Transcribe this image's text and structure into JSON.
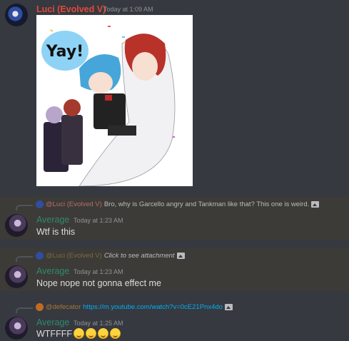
{
  "messages": [
    {
      "author": "Luci (Evolved V)",
      "timestamp": "Today at 1:09 AM",
      "author_color": "#e04a3a",
      "attachment": {
        "kind": "image",
        "caption_text": "Yay!"
      }
    },
    {
      "reply": {
        "author": "@Luci (Evolved V)",
        "text": "Bro, why is Garcello angry and Tankman like that? This one is weird.",
        "has_image_icon": true
      },
      "author": "Average",
      "author_color": "#2f8a6e",
      "timestamp": "Today at 1:23 AM",
      "text": "Wtf is this"
    },
    {
      "reply": {
        "author": "@Luci (Evolved V)",
        "text": "Click to see attachment",
        "has_image_icon": true
      },
      "author": "Average",
      "author_color": "#2f8a6e",
      "timestamp": "Today at 1:23 AM",
      "text": "Nope nope not gonna effect me"
    },
    {
      "reply": {
        "author": "@defecator",
        "text": "https://m.youtube.com/watch?v=0cE21Pnx4do",
        "has_image_icon": true
      },
      "author": "Average",
      "author_color": "#2f8a6e",
      "timestamp": "Today at 1:25 AM",
      "text": "WTFFFF",
      "emojis": [
        "laughing-emoji",
        "laughing-emoji",
        "laughing-emoji",
        "laughing-emoji"
      ]
    }
  ],
  "colors": {
    "background": "#36393f",
    "highlight": "#3d3b37",
    "link": "#00aff4",
    "timestamp": "#8e9297"
  }
}
